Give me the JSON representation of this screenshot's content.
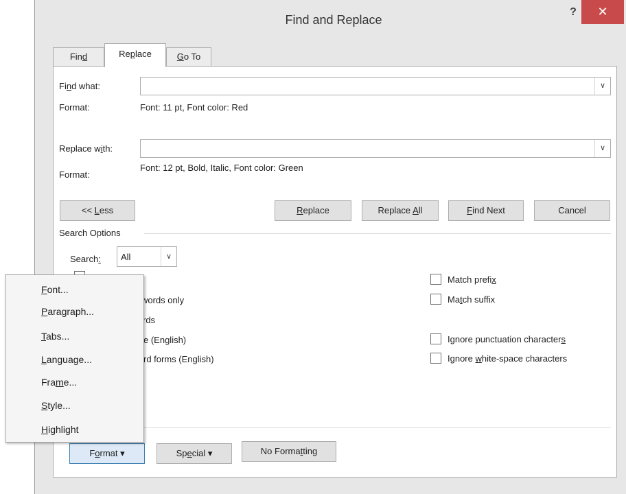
{
  "dialog": {
    "title": "Find and Replace",
    "help_glyph": "?",
    "close_glyph": "✕"
  },
  "tabs": [
    {
      "label_pre": "Fin",
      "label_u": "d",
      "label_post": ""
    },
    {
      "label_pre": "Re",
      "label_u": "p",
      "label_post": "lace"
    },
    {
      "label_pre": "",
      "label_u": "G",
      "label_post": "o To"
    }
  ],
  "find": {
    "label_pre": "Fi",
    "label_u": "n",
    "label_post": "d what:",
    "value": "",
    "format_label": "Format:",
    "format_value": "Font: 11 pt, Font color: Red"
  },
  "replace": {
    "label_pre": "Replace w",
    "label_u": "i",
    "label_post": "th:",
    "value": "",
    "format_label": "Format:",
    "format_value": "Font: 12 pt, Bold, Italic, Font color: Green"
  },
  "buttons": {
    "less_pre": "<< ",
    "less_u": "L",
    "less_post": "ess",
    "replace_pre": "",
    "replace_u": "R",
    "replace_post": "eplace",
    "replace_all_pre": "Replace ",
    "replace_all_u": "A",
    "replace_all_post": "ll",
    "find_next_pre": "",
    "find_next_u": "F",
    "find_next_post": "ind Next",
    "cancel": "Cancel"
  },
  "search_options": {
    "heading": "Search Options",
    "search_label_pre": "Search",
    "search_label_u": ":",
    "search_label_post": "",
    "search_value": "All",
    "left_partial": [
      " words only",
      "rds",
      "e (English)",
      "rd forms (English)"
    ],
    "right_options": [
      {
        "pre": "Match prefi",
        "u": "x",
        "post": "",
        "checked": false
      },
      {
        "pre": "Ma",
        "u": "t",
        "post": "ch suffix",
        "checked": false
      },
      {
        "pre": "Ignore punctuation character",
        "u": "s",
        "post": "",
        "checked": false
      },
      {
        "pre": "Ignore ",
        "u": "w",
        "post": "hite-space characters",
        "checked": false
      }
    ]
  },
  "bottom_buttons": {
    "format_pre": "F",
    "format_u": "o",
    "format_post": "rmat",
    "special_pre": "Sp",
    "special_u": "e",
    "special_post": "cial",
    "no_formatting_pre": "No Forma",
    "no_formatting_u": "t",
    "no_formatting_post": "ting",
    "dropdown_glyph": "▾"
  },
  "format_menu": [
    {
      "pre": "",
      "u": "F",
      "post": "ont..."
    },
    {
      "pre": "",
      "u": "P",
      "post": "aragraph..."
    },
    {
      "pre": "",
      "u": "T",
      "post": "abs..."
    },
    {
      "pre": "",
      "u": "L",
      "post": "anguage..."
    },
    {
      "pre": "Fra",
      "u": "m",
      "post": "e..."
    },
    {
      "pre": "",
      "u": "S",
      "post": "tyle..."
    },
    {
      "pre": "",
      "u": "H",
      "post": "ighlight"
    }
  ],
  "colors": {
    "close_bg": "#c94a4a",
    "focus_border": "#3c7fb1"
  },
  "icons": {
    "combo_arrow": "chevron-down-icon",
    "close": "close-icon",
    "help": "help-icon"
  }
}
